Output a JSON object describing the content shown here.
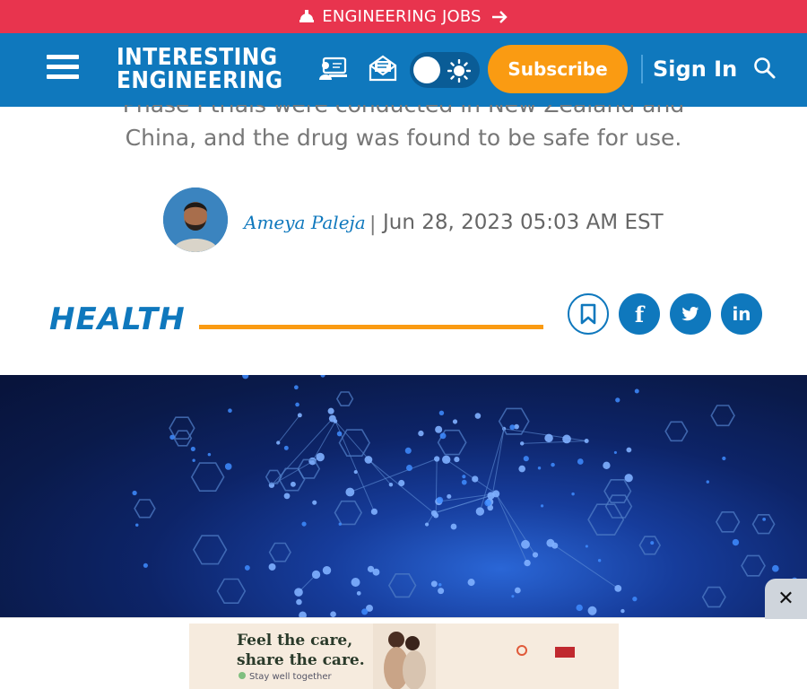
{
  "jobs_bar": {
    "label": "ENGINEERING JOBS"
  },
  "header": {
    "logo_line1": "INTERESTING",
    "logo_line2": "ENGINEERING",
    "subscribe_label": "Subscribe",
    "signin_label": "Sign In"
  },
  "article": {
    "summary_line1": "Phase I trials were conducted in New Zealand and",
    "summary_line2": "China, and the drug was found to be safe for use.",
    "author": "Ameya Paleja",
    "separator": "|",
    "date": "Jun 28, 2023 05:03 AM EST",
    "category": "HEALTH"
  },
  "social": {
    "facebook_glyph": "f",
    "twitter_glyph": "t",
    "linkedin_glyph": "in"
  },
  "ad": {
    "headline_line1": "Feel the care,",
    "headline_line2": "share the care.",
    "tagline": "Stay well together",
    "close_glyph": "✕"
  },
  "colors": {
    "jobs_bar": "#e8344e",
    "header": "#0f78bd",
    "accent": "#fa9b12"
  }
}
